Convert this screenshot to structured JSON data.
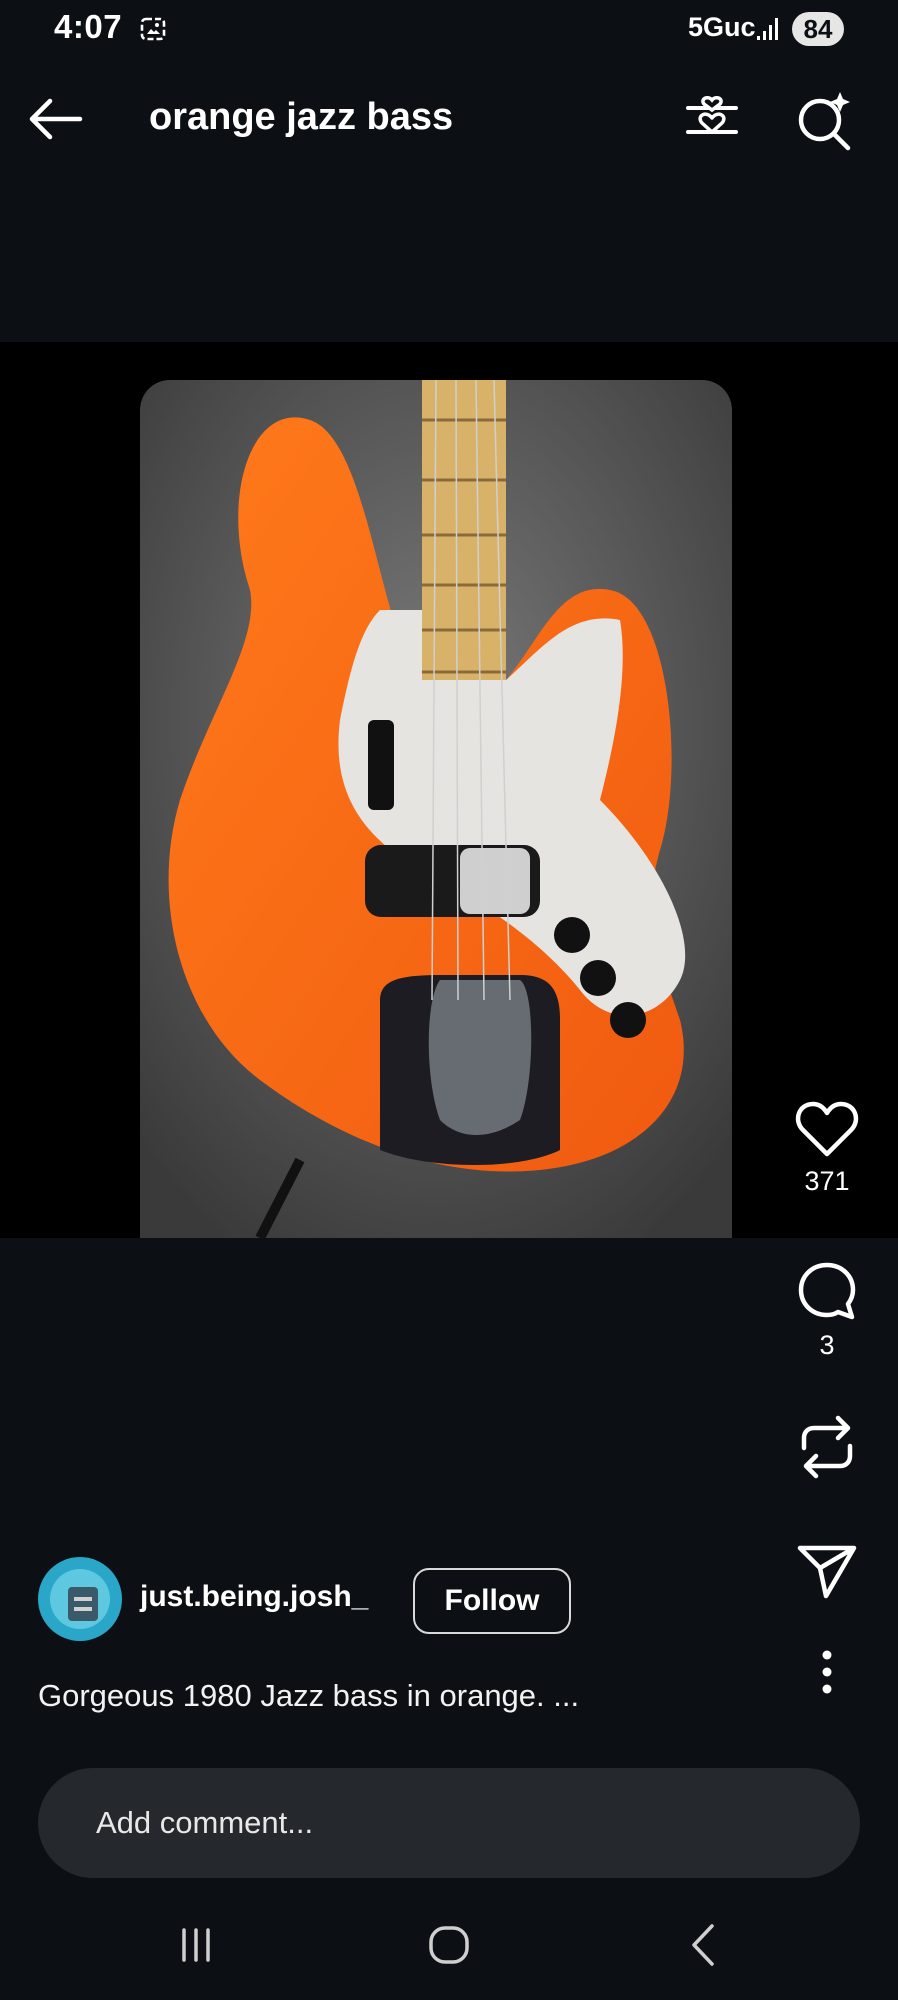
{
  "status_bar": {
    "time": "4:07",
    "network": "5Guc",
    "battery": "84",
    "icons": [
      "gallery-notification-icon",
      "signal-icon",
      "battery-icon"
    ]
  },
  "header": {
    "title": "orange jazz bass",
    "icons": [
      "back-arrow-icon",
      "like-filter-icon",
      "visual-search-icon"
    ]
  },
  "post": {
    "image_description_icon": "orange-bass-guitar-photo",
    "actions": {
      "like_count": "371",
      "comment_count": "3",
      "icons": [
        "heart-icon",
        "comment-bubble-icon",
        "repost-icon",
        "send-icon",
        "more-vertical-icon"
      ]
    },
    "author": {
      "username": "just.being.josh_",
      "follow_label": "Follow"
    },
    "caption": "Gorgeous 1980 Jazz bass in orange. ..."
  },
  "comment_input": {
    "placeholder": "Add comment..."
  },
  "system_nav": {
    "icons": [
      "recents-icon",
      "home-icon",
      "back-icon"
    ]
  },
  "colors": {
    "background": "#0c1014",
    "media_band": "#000000",
    "comment_box": "#25292e",
    "text": "#ffffff"
  }
}
